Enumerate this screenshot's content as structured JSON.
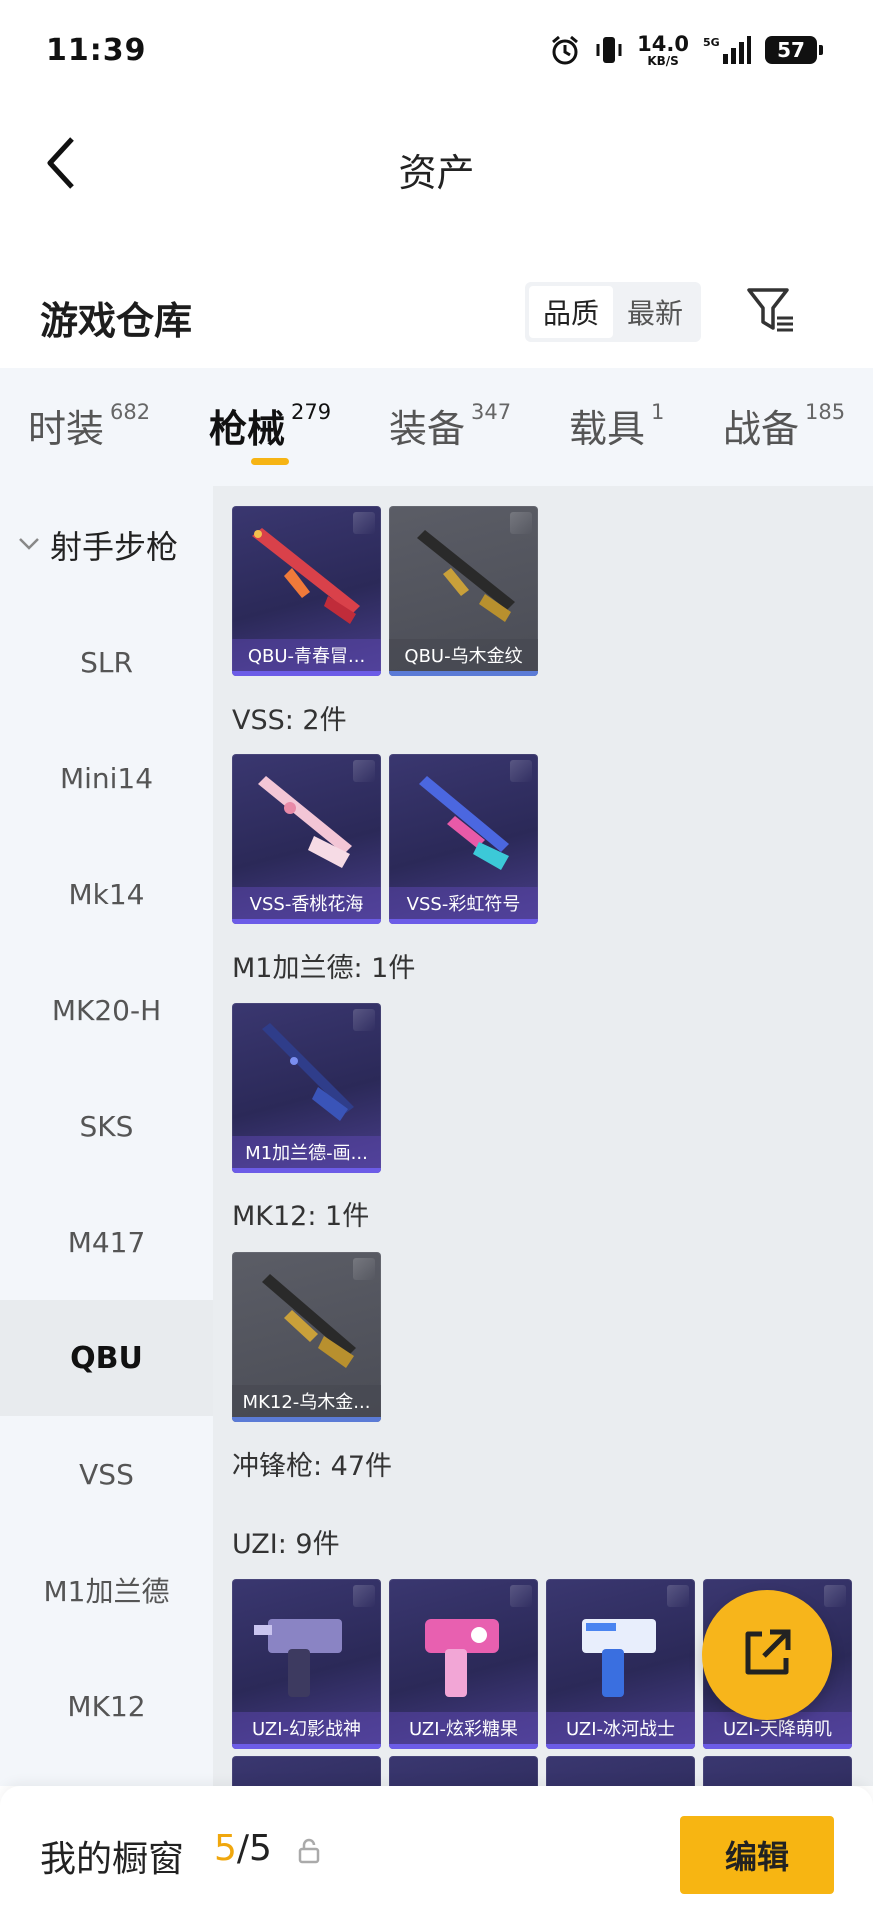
{
  "status_bar": {
    "time": "11:39",
    "net_speed": "14.0",
    "net_unit": "KB/S",
    "battery": "57"
  },
  "nav": {
    "title": "资产",
    "back_icon": "chevron-left-icon"
  },
  "section": {
    "title": "游戏仓库",
    "sort_options": [
      "品质",
      "最新"
    ],
    "sort_selected": "品质",
    "filter_icon": "filter-icon"
  },
  "tabs": [
    {
      "label": "时装",
      "count": "682"
    },
    {
      "label": "枪械",
      "count": "279"
    },
    {
      "label": "装备",
      "count": "347"
    },
    {
      "label": "载具",
      "count": "1"
    },
    {
      "label": "战备",
      "count": "185"
    }
  ],
  "active_tab": "枪械",
  "sidebar": {
    "group": "射手步枪",
    "items": [
      "SLR",
      "Mini14",
      "Mk14",
      "MK20-H",
      "SKS",
      "M417",
      "QBU",
      "VSS",
      "M1加兰德",
      "MK12"
    ],
    "selected": "QBU"
  },
  "content": {
    "qbu_cards": [
      "QBU-青春冒...",
      "QBU-乌木金纹"
    ],
    "vss_label": "VSS: 2件",
    "vss_cards": [
      "VSS-香桃花海",
      "VSS-彩虹符号"
    ],
    "m1_label": "M1加兰德: 1件",
    "m1_cards": [
      "M1加兰德-画..."
    ],
    "mk12_label": "MK12: 1件",
    "mk12_cards": [
      "MK12-乌木金..."
    ],
    "smg_label": "冲锋枪: 47件",
    "uzi_label": "UZI: 9件",
    "uzi_cards": [
      "UZI-幻影战神",
      "UZI-炫彩糖果",
      "UZI-冰河战士",
      "UZI-天降萌叽"
    ]
  },
  "fab": {
    "icon": "share-external-icon"
  },
  "bottom": {
    "title": "我的橱窗",
    "count_current": "5",
    "count_sep": "/",
    "count_max": "5",
    "edit_label": "编辑",
    "lock_icon": "lock-icon"
  },
  "colors": {
    "accent": "#f7b512",
    "card_purple": "#2b2958",
    "sidebar_bg": "#f3f6fa",
    "content_bg": "#eaedf0"
  }
}
